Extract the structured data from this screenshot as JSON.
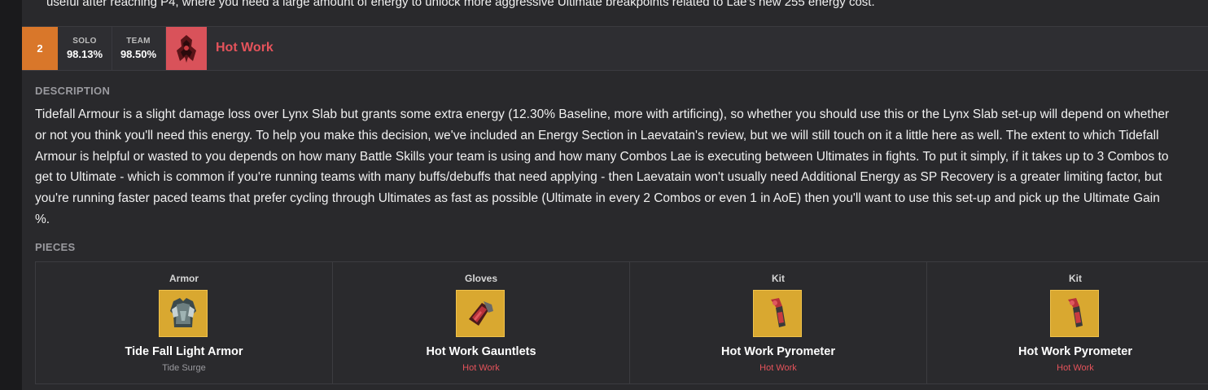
{
  "intro_text": "useful after reaching P4, where you need a large amount of energy to unlock more aggressive Ultimate breakpoints related to Lae's new 255 energy cost.",
  "set_row": {
    "rank": "2",
    "solo_label": "SOLO",
    "solo_value": "98.13%",
    "team_label": "TEAM",
    "team_value": "98.50%",
    "set_name": "Hot Work",
    "set_icon": "hot-work-set-icon"
  },
  "description": {
    "label": "DESCRIPTION",
    "lines": [
      "Tidefall Armour is a slight damage loss over Lynx Slab but grants some extra energy (12.30% Baseline, more with artificing), so whether you should use this or the Lynx Slab set-up will depend on whether",
      "or not you think you'll need this energy. To help you make this decision, we've included an Energy Section in Laevatain's review, but we will still touch on it a little here as well. The extent to which Tidefall",
      "Armour is helpful or wasted to you depends on how many Battle Skills your team is using and how many Combos Lae is executing between Ultimates in fights. To put it simply, if it takes up to 3 Combos to",
      "get to Ultimate - which is common if you're running teams with many buffs/debuffs that need applying - then Laevatain won't usually need Additional Energy as SP Recovery is a greater limiting factor, but",
      "you're running faster paced teams that prefer cycling through Ultimates as fast as possible (Ultimate in every 2 Combos or even 1 in AoE) then you'll want to use this set-up and pick up the Ultimate Gain",
      "%."
    ]
  },
  "pieces": {
    "label": "PIECES",
    "items": [
      {
        "slot": "Armor",
        "name": "Tide Fall Light Armor",
        "set": "Tide Surge",
        "set_color": "#9a9a9f",
        "icon": "armor-icon"
      },
      {
        "slot": "Gloves",
        "name": "Hot Work Gauntlets",
        "set": "Hot Work",
        "set_color": "#e5535b",
        "icon": "gauntlets-icon"
      },
      {
        "slot": "Kit",
        "name": "Hot Work Pyrometer",
        "set": "Hot Work",
        "set_color": "#e5535b",
        "icon": "pyrometer-icon"
      },
      {
        "slot": "Kit",
        "name": "Hot Work Pyrometer",
        "set": "Hot Work",
        "set_color": "#e5535b",
        "icon": "pyrometer-icon"
      }
    ]
  },
  "colors": {
    "rank_bg": "#d9772a",
    "set_accent": "#e5535b",
    "item_frame": "#d9a830"
  }
}
